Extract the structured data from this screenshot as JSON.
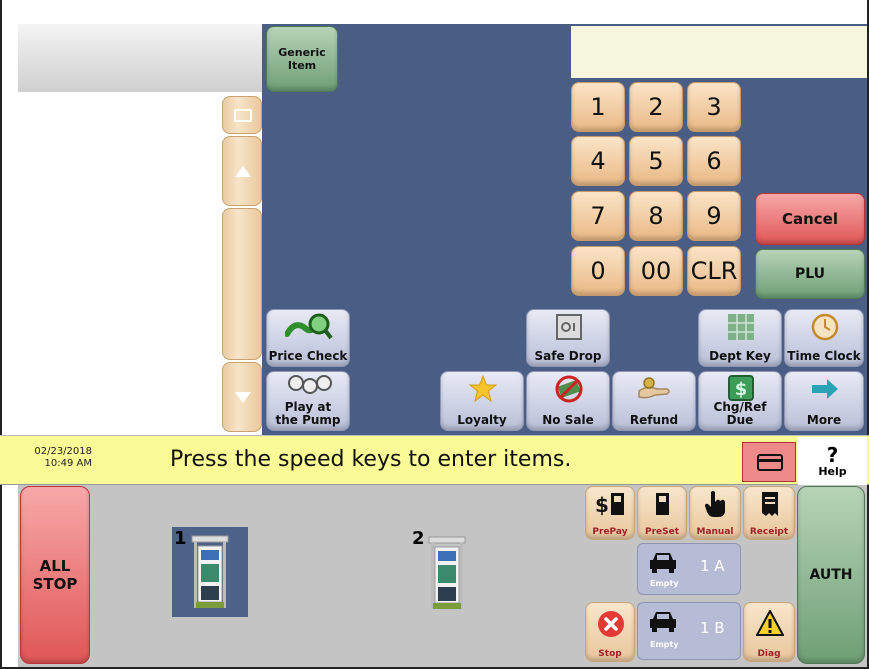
{
  "toolbar": {
    "generic_item": "Generic Item",
    "price_check": "Price Check",
    "safe_drop": "Safe Drop",
    "dept_key": "Dept Key",
    "time_clock": "Time Clock",
    "play_at_pump": "Play at the Pump",
    "loyalty": "Loyalty",
    "no_sale": "No Sale",
    "refund": "Refund",
    "chg_ref_due": "Chg/Ref Due",
    "more": "More"
  },
  "keypad": {
    "keys": [
      "1",
      "2",
      "3",
      "4",
      "5",
      "6",
      "7",
      "8",
      "9",
      "0",
      "00",
      "CLR"
    ],
    "cancel": "Cancel",
    "plu": "PLU"
  },
  "status": {
    "date": "02/23/2018",
    "time": "10:49 AM",
    "message": "Press the speed keys to enter items.",
    "help": "Help",
    "help_glyph": "?"
  },
  "pumps": {
    "all_stop": "ALL STOP",
    "auth": "AUTH",
    "pump1_number": "1",
    "pump2_number": "2",
    "prepay": "PrePay",
    "preset": "PreSet",
    "manual": "Manual",
    "receipt": "Receipt",
    "stop": "Stop",
    "diag": "Diag",
    "lane_a_status": "Empty",
    "lane_a_id": "1 A",
    "lane_b_status": "Empty",
    "lane_b_id": "1 B"
  },
  "colors": {
    "panel_blue": "#4a5d84",
    "status_yellow": "#fafa96",
    "cancel_red": "#e05656",
    "plu_green": "#6e9f75"
  }
}
